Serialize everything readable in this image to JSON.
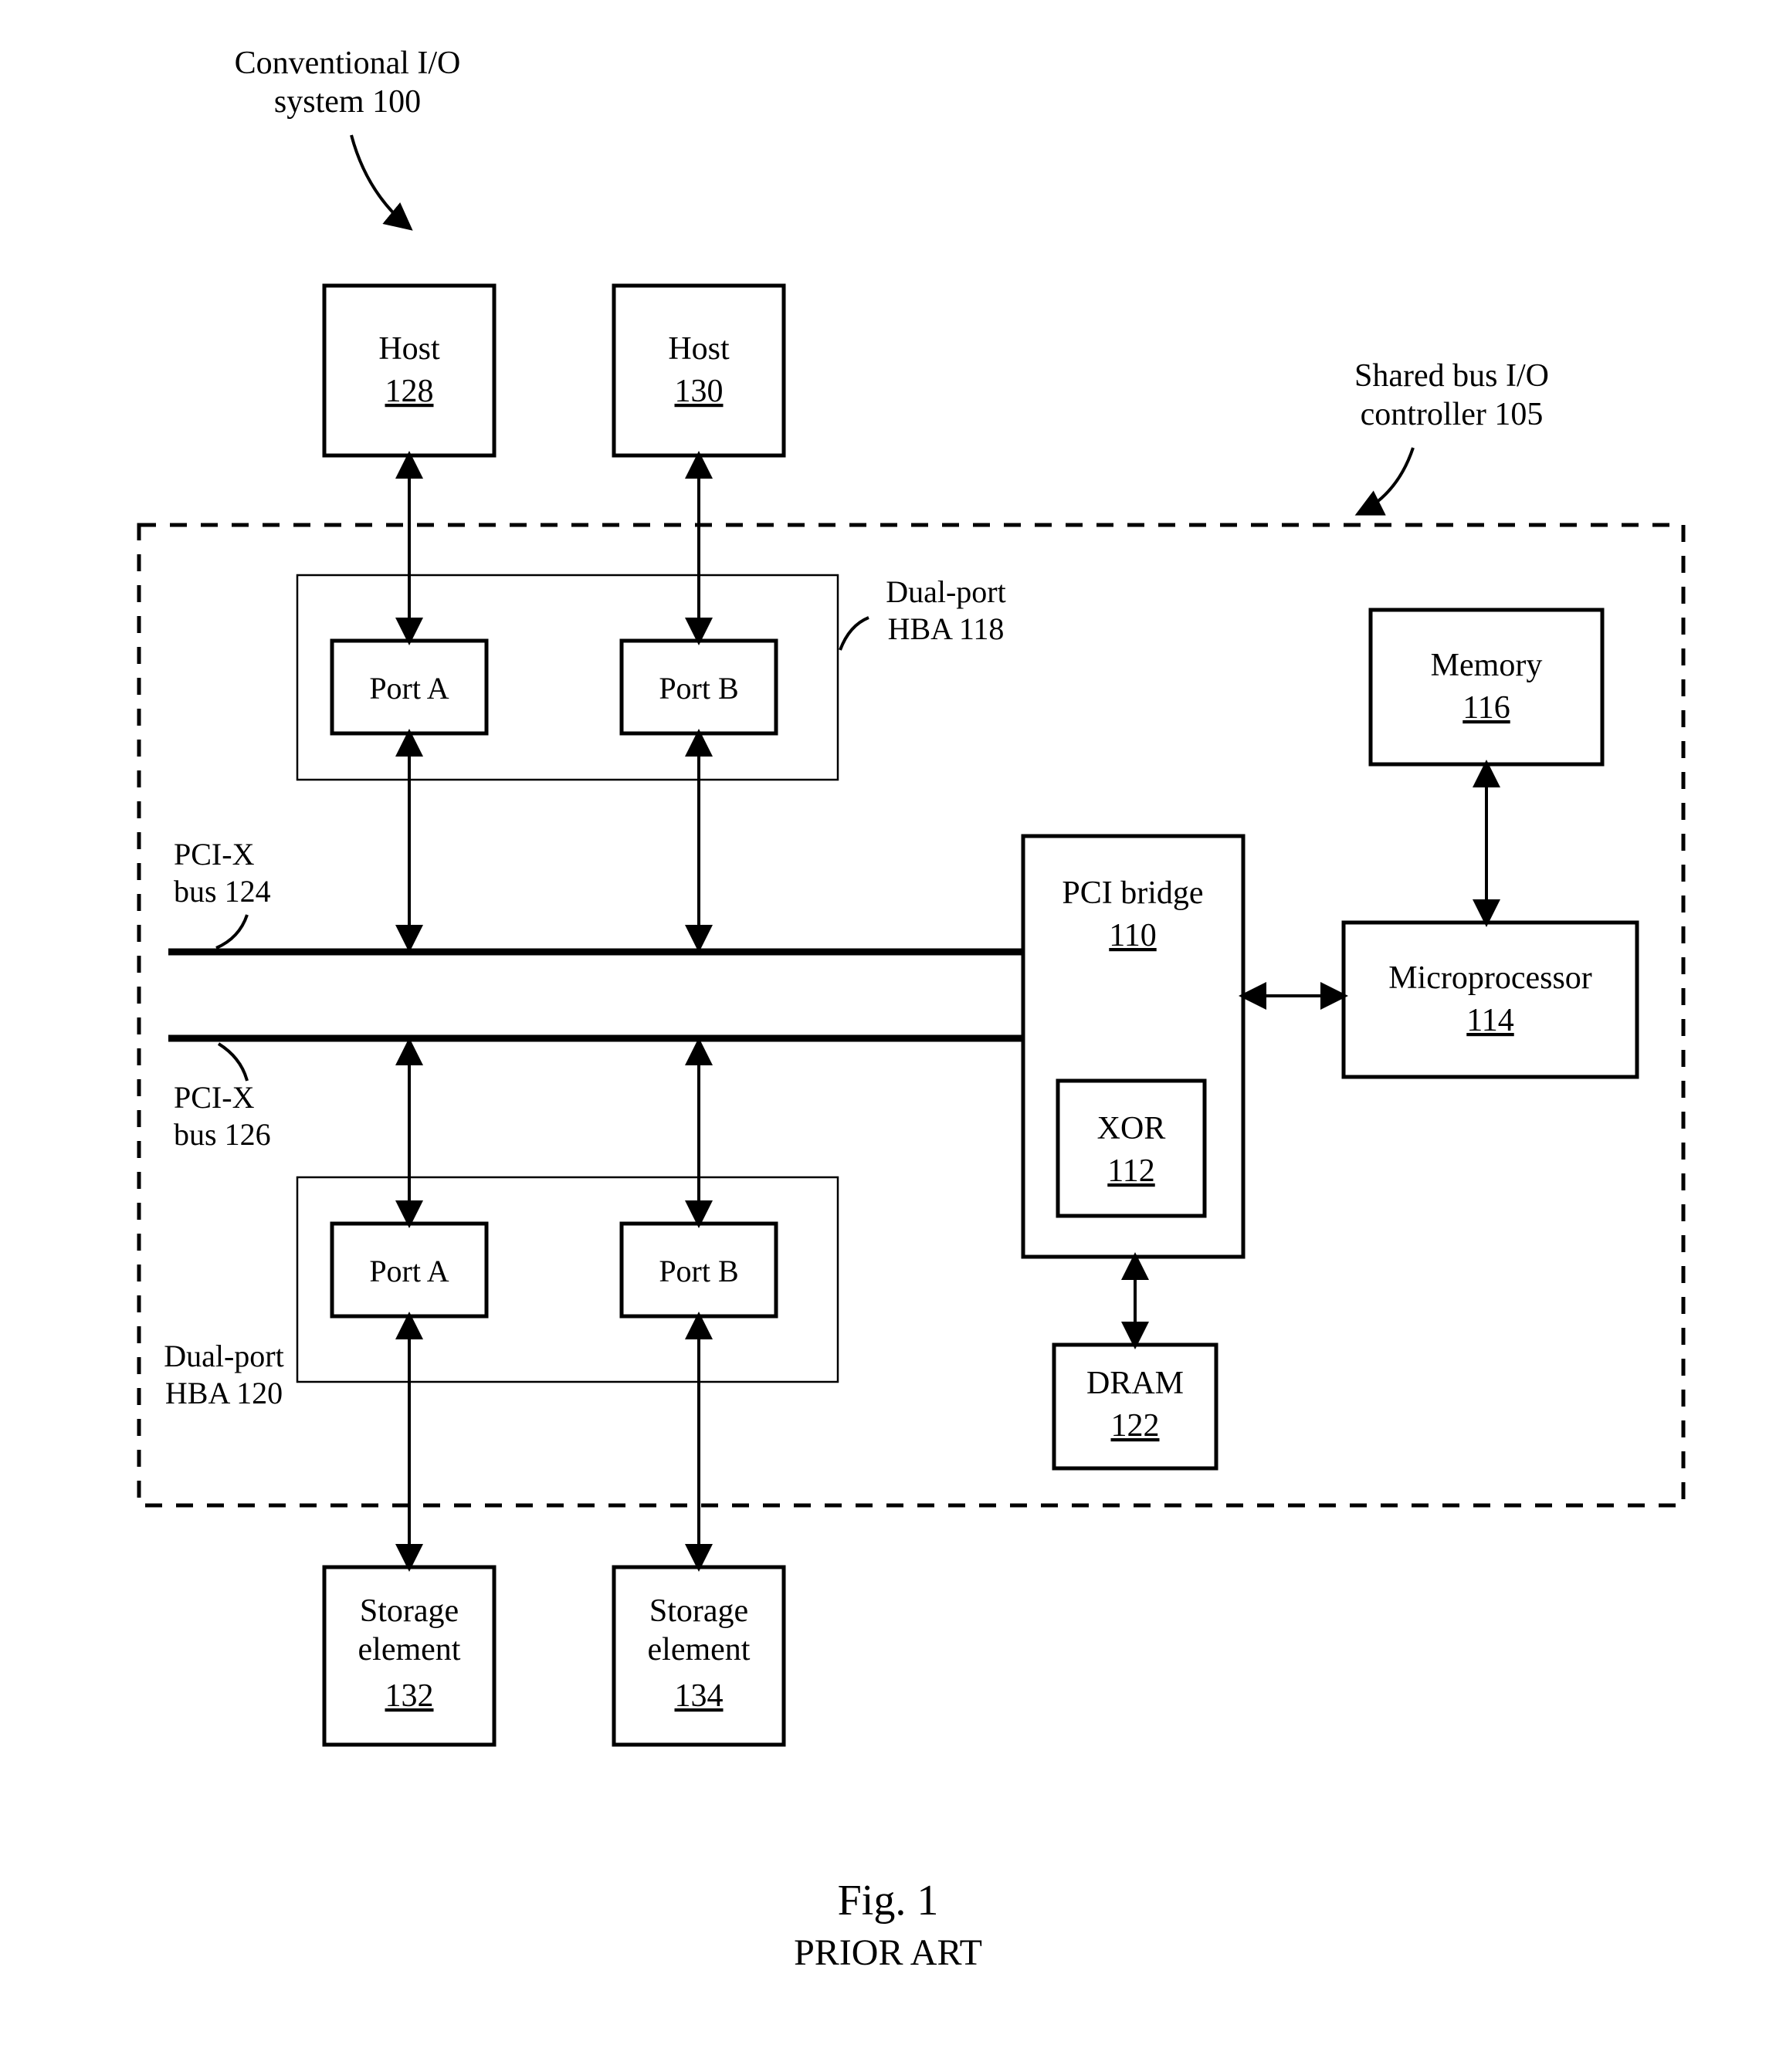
{
  "title_top": {
    "l1": "Conventional I/O",
    "l2": "system 100"
  },
  "controller_label": {
    "l1": "Shared bus I/O",
    "l2": "controller 105"
  },
  "host1": {
    "name": "Host",
    "ref": "128"
  },
  "host2": {
    "name": "Host",
    "ref": "130"
  },
  "hba_top_label": {
    "l1": "Dual-port",
    "l2": "HBA 118"
  },
  "hba_bot_label": {
    "l1": "Dual-port",
    "l2": "HBA 120"
  },
  "portA": "Port A",
  "portB": "Port B",
  "bus_top": {
    "l1": "PCI-X",
    "l2": "bus 124"
  },
  "bus_bot": {
    "l1": "PCI-X",
    "l2": "bus 126"
  },
  "bridge": {
    "name": "PCI bridge",
    "ref": "110"
  },
  "xor": {
    "name": "XOR",
    "ref": "112"
  },
  "dram": {
    "name": "DRAM",
    "ref": "122"
  },
  "memory": {
    "name": "Memory",
    "ref": "116"
  },
  "micro": {
    "name": "Microprocessor",
    "ref": "114"
  },
  "storage1": {
    "l1": "Storage",
    "l2": "element",
    "ref": "132"
  },
  "storage2": {
    "l1": "Storage",
    "l2": "element",
    "ref": "134"
  },
  "caption": {
    "l1": "Fig. 1",
    "l2": "PRIOR ART"
  }
}
